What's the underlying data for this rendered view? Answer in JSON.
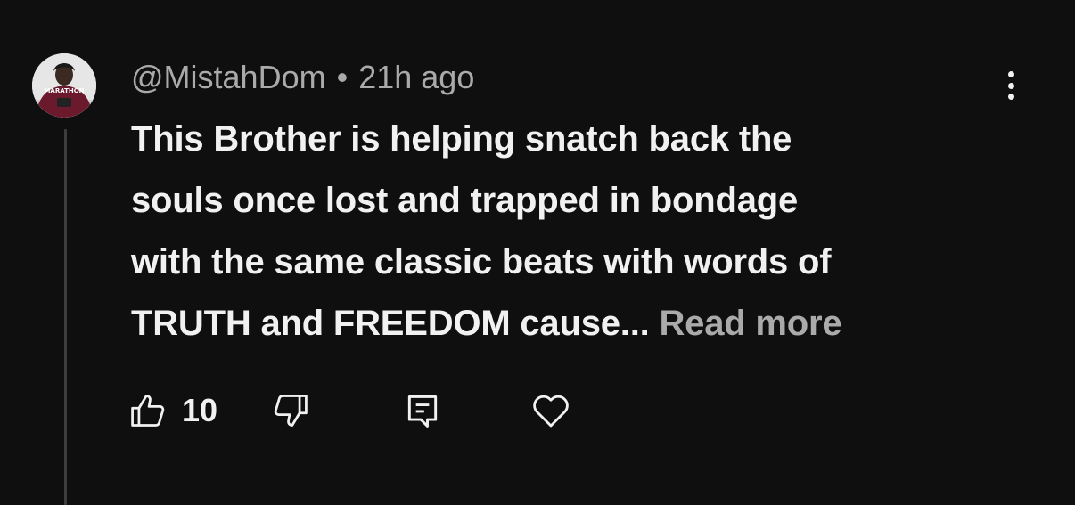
{
  "comment": {
    "author": "@MistahDom",
    "separator": "•",
    "timestamp": "21h ago",
    "text_lines": [
      "This Brother is helping snatch back the",
      "souls once lost and trapped in bondage",
      "with the same classic beats with words of",
      "TRUTH and FREEDOM cause..."
    ],
    "read_more_label": "Read more",
    "like_count": "10",
    "avatar_text": "MARATHON"
  },
  "icons": {
    "like": "thumbs-up-icon",
    "dislike": "thumbs-down-icon",
    "reply": "comment-reply-icon",
    "heart": "heart-icon",
    "menu": "more-vertical-icon"
  },
  "colors": {
    "background": "#0f0f0f",
    "primary_text": "#f1f1f1",
    "secondary_text": "#aaaaaa",
    "thread_line": "#3d3d3d",
    "avatar_shirt": "#6b1a2e"
  }
}
